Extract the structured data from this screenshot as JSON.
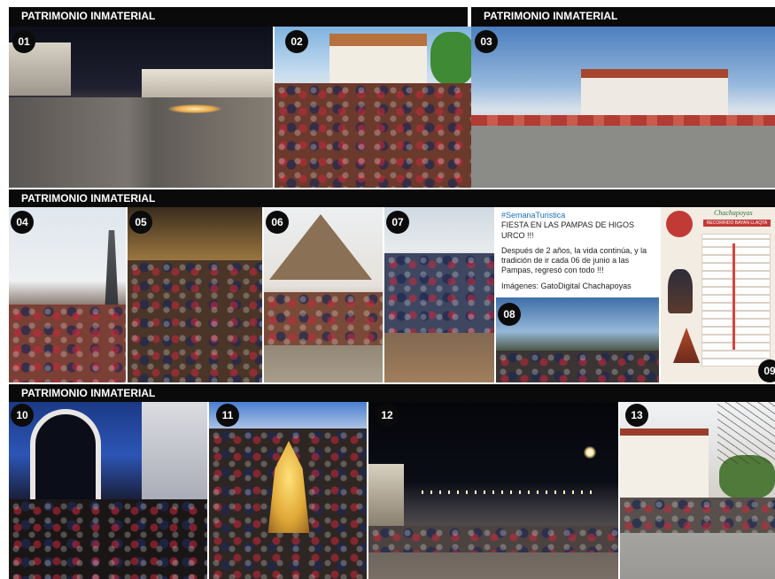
{
  "bands": {
    "top_left": "PATRIMONIO INMATERIAL",
    "top_right": "PATRIMONIO INMATERIAL",
    "middle": "PATRIMONIO INMATERIAL",
    "bottom": "PATRIMONIO INMATERIAL"
  },
  "photos": [
    {
      "num": "01"
    },
    {
      "num": "02"
    },
    {
      "num": "03"
    },
    {
      "num": "04"
    },
    {
      "num": "05"
    },
    {
      "num": "06"
    },
    {
      "num": "07"
    },
    {
      "num": "08"
    },
    {
      "num": "09"
    },
    {
      "num": "10"
    },
    {
      "num": "11"
    },
    {
      "num": "12"
    },
    {
      "num": "13"
    }
  ],
  "post": {
    "hashtag": "#SemanaTuristica",
    "title": "FIESTA EN LAS PAMPAS DE HIGOS URCO !!!",
    "body": "Después de 2 años, la vida continúa, y la tradición de ir cada 06 de junio a las Pampas, regresó con todo !!!",
    "credit": "Imágenes: GatoDigital Chachapoyas"
  },
  "map_card": {
    "brand": "Chachapoyas",
    "heading": "RECORRIDO BAYAN LLAQTA"
  }
}
